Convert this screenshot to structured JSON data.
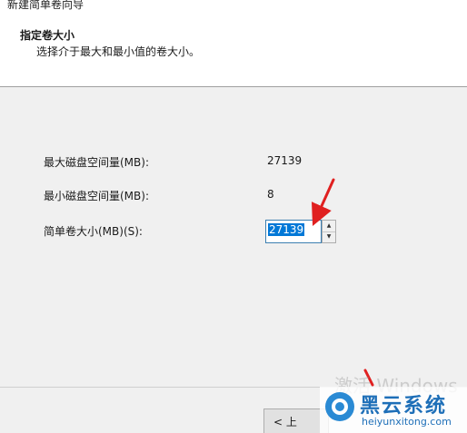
{
  "window": {
    "title": "新建简单卷向导"
  },
  "header": {
    "heading": "指定卷大小",
    "subheading": "选择介于最大和最小值的卷大小。"
  },
  "form": {
    "max_label": "最大磁盘空间量(MB):",
    "max_value": "27139",
    "min_label": "最小磁盘空间量(MB):",
    "min_value": "8",
    "size_label": "简单卷大小(MB)(S):",
    "size_value": "27139"
  },
  "footer": {
    "back_label": "< 上"
  },
  "overlay": {
    "activate_text": "激活 Windows",
    "watermark_name": "黑云系统",
    "watermark_url": "heiyunxitong.com"
  },
  "colors": {
    "selection": "#0078d7",
    "arrow": "#e02020",
    "watermark": "#1e6fb8"
  }
}
